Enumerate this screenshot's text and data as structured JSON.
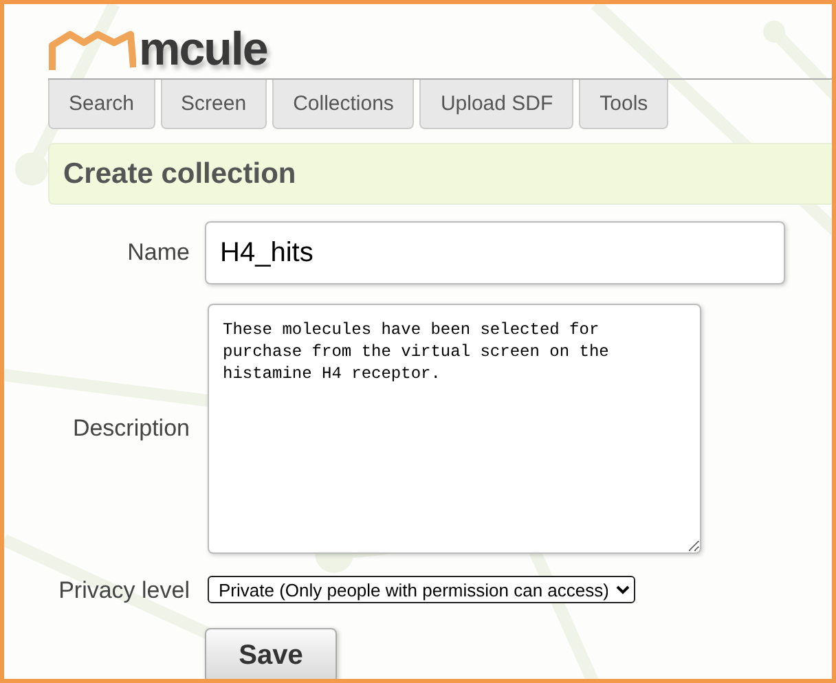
{
  "logo": {
    "text": "mcule"
  },
  "tabs": [
    {
      "label": "Search"
    },
    {
      "label": "Screen"
    },
    {
      "label": "Collections"
    },
    {
      "label": "Upload SDF"
    },
    {
      "label": "Tools"
    }
  ],
  "heading": "Create collection",
  "form": {
    "name": {
      "label": "Name",
      "value": "H4_hits"
    },
    "description": {
      "label": "Description",
      "value": "These molecules have been selected for purchase from the virtual screen on the histamine H4 receptor."
    },
    "privacy": {
      "label": "Privacy level",
      "value": "Private (Only people with permission can access)"
    },
    "save": "Save"
  }
}
